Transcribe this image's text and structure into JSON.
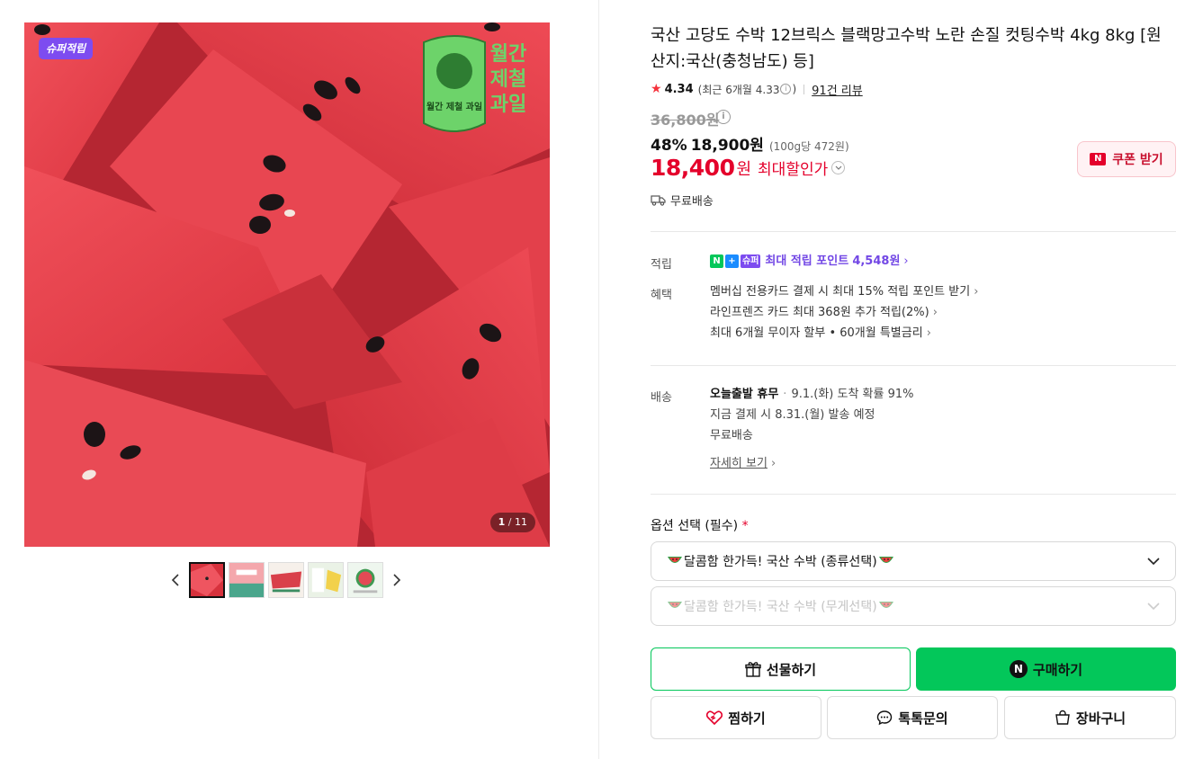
{
  "gallery": {
    "badge": "슈퍼적립",
    "counter_current": "1",
    "counter_total": "11",
    "logo_text": "월간 제철 과일",
    "thumbnails": 5,
    "active_thumbnail": 1
  },
  "product": {
    "title": "국산 고당도 수박 12브릭스 블랙망고수박 노란 손질 컷팅수박 4kg 8kg [원산지:국산(충청남도) 등]",
    "rating": "4.34",
    "rating_recent": "(최근 6개월 4.33",
    "rating_recent_close": ")",
    "review_count": "91건 리뷰",
    "original_price": "36,800원",
    "discount_rate": "48%",
    "sale_price": "18,900원",
    "unit_price": "(100g당 472원)",
    "max_discount_price": "18,400",
    "max_discount_won": "원",
    "max_discount_label": "최대할인가",
    "coupon_button": "쿠폰 받기",
    "shipping_badge": "무료배송"
  },
  "points": {
    "label": "적립",
    "icons": [
      "N",
      "+",
      "슈퍼"
    ],
    "text": "최대 적립 포인트",
    "amount": "4,548원"
  },
  "benefits": {
    "label": "혜택",
    "items": [
      "멤버십 전용카드 결제 시 최대 15% 적립 포인트 받기",
      "라인프렌즈 카드 최대 368원 추가 적립(2%)",
      "최대 6개월 무이자 할부 • 60개월 특별금리"
    ]
  },
  "delivery": {
    "label": "배송",
    "today": "오늘출발 휴무",
    "arrival": "9.1.(화) 도착 확률 91%",
    "ship_note": "지금 결제 시 8.31.(월) 발송 예정",
    "fee": "무료배송",
    "detail_link": "자세히 보기"
  },
  "options": {
    "label": "옵션 선택 (필수)",
    "required_mark": "*",
    "select1": "달콤함 한가득! 국산 수박 (종류선택)",
    "select2": "달콤함 한가득! 국산 수박 (무게선택)"
  },
  "actions": {
    "gift": "선물하기",
    "buy": "구매하기",
    "buy_badge": "N",
    "zzim": "찜하기",
    "talk": "톡톡문의",
    "cart": "장바구니"
  },
  "colors": {
    "accent_green": "#03c75a",
    "price_red": "#e4002b",
    "points_purple": "#7247e5"
  }
}
